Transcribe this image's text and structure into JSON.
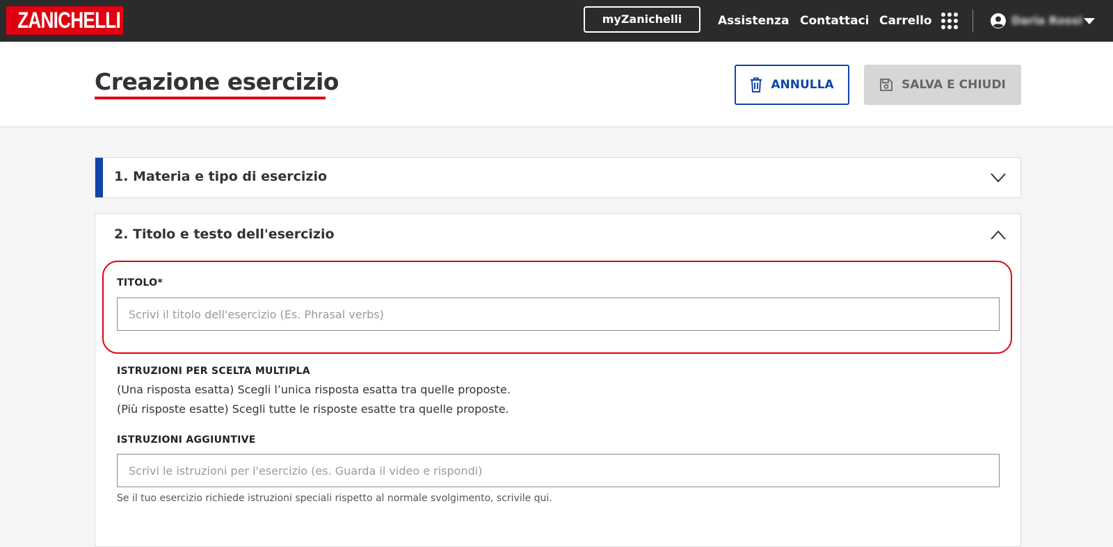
{
  "topbar": {
    "logo": "ZANICHELLI",
    "my_button": "myZanichelli",
    "links": [
      "Assistenza",
      "Contattaci",
      "Carrello"
    ],
    "username": "Daria Rossi",
    "icons": [
      "apps-grid-icon",
      "user-avatar-icon",
      "caret-down-icon"
    ]
  },
  "header": {
    "title": "Creazione esercizio",
    "cancel_label": "ANNULLA",
    "save_label": "SALVA E CHIUDI",
    "icons": [
      "trash-icon",
      "save-icon"
    ]
  },
  "sections": [
    {
      "label": "1. Materia e tipo di esercizio",
      "expanded": false
    },
    {
      "label": "2. Titolo e testo dell'esercizio",
      "expanded": true
    }
  ],
  "form": {
    "title_label": "TITOLO*",
    "title_placeholder": "Scrivi il titolo dell'esercizio (Es. Phrasal verbs)",
    "title_value": "",
    "mc_label": "ISTRUZIONI PER SCELTA MULTIPLA",
    "mc_lines": [
      "(Una risposta esatta) Scegli l’unica risposta esatta tra quelle proposte.",
      "(Più risposte esatte) Scegli tutte le risposte esatte tra quelle proposte."
    ],
    "extra_label": "ISTRUZIONI AGGIUNTIVE",
    "extra_placeholder": "Scrivi le istruzioni per l'esercizio (es. Guarda il video e rispondi)",
    "extra_value": "",
    "extra_hint": "Se il tuo esercizio richiede istruzioni speciali rispetto al normale svolgimento, scrivile qui."
  },
  "colors": {
    "brand_red": "#e1000f",
    "accent_blue": "#1245a8",
    "topbar_bg": "#2b2b2b"
  }
}
